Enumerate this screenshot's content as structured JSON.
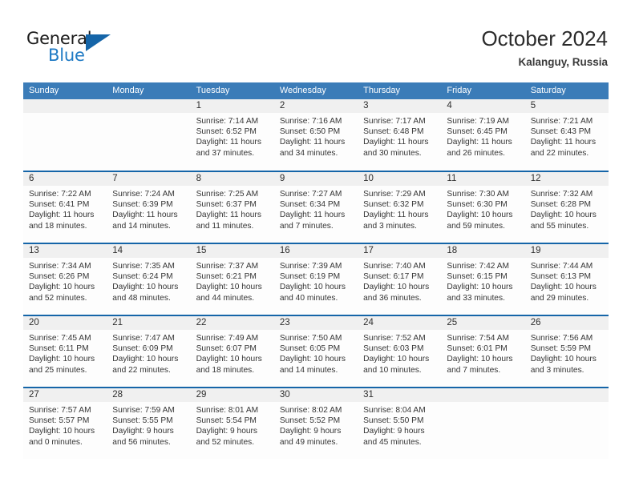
{
  "brand": {
    "name_part1": "General",
    "name_part2": "Blue",
    "accent_color": "#1f7ac4",
    "triangle_color": "#1565a8"
  },
  "header": {
    "title": "October 2024",
    "subtitle": "Kalanguy, Russia"
  },
  "calendar": {
    "header_color": "#3b7cb8",
    "row_rule_color": "#1565a8",
    "day_band_color": "#f0f0f0",
    "weekdays": [
      "Sunday",
      "Monday",
      "Tuesday",
      "Wednesday",
      "Thursday",
      "Friday",
      "Saturday"
    ],
    "weeks": [
      [
        {
          "day": "",
          "info": ""
        },
        {
          "day": "",
          "info": ""
        },
        {
          "day": "1",
          "info": "Sunrise: 7:14 AM\nSunset: 6:52 PM\nDaylight: 11 hours and 37 minutes."
        },
        {
          "day": "2",
          "info": "Sunrise: 7:16 AM\nSunset: 6:50 PM\nDaylight: 11 hours and 34 minutes."
        },
        {
          "day": "3",
          "info": "Sunrise: 7:17 AM\nSunset: 6:48 PM\nDaylight: 11 hours and 30 minutes."
        },
        {
          "day": "4",
          "info": "Sunrise: 7:19 AM\nSunset: 6:45 PM\nDaylight: 11 hours and 26 minutes."
        },
        {
          "day": "5",
          "info": "Sunrise: 7:21 AM\nSunset: 6:43 PM\nDaylight: 11 hours and 22 minutes."
        }
      ],
      [
        {
          "day": "6",
          "info": "Sunrise: 7:22 AM\nSunset: 6:41 PM\nDaylight: 11 hours and 18 minutes."
        },
        {
          "day": "7",
          "info": "Sunrise: 7:24 AM\nSunset: 6:39 PM\nDaylight: 11 hours and 14 minutes."
        },
        {
          "day": "8",
          "info": "Sunrise: 7:25 AM\nSunset: 6:37 PM\nDaylight: 11 hours and 11 minutes."
        },
        {
          "day": "9",
          "info": "Sunrise: 7:27 AM\nSunset: 6:34 PM\nDaylight: 11 hours and 7 minutes."
        },
        {
          "day": "10",
          "info": "Sunrise: 7:29 AM\nSunset: 6:32 PM\nDaylight: 11 hours and 3 minutes."
        },
        {
          "day": "11",
          "info": "Sunrise: 7:30 AM\nSunset: 6:30 PM\nDaylight: 10 hours and 59 minutes."
        },
        {
          "day": "12",
          "info": "Sunrise: 7:32 AM\nSunset: 6:28 PM\nDaylight: 10 hours and 55 minutes."
        }
      ],
      [
        {
          "day": "13",
          "info": "Sunrise: 7:34 AM\nSunset: 6:26 PM\nDaylight: 10 hours and 52 minutes."
        },
        {
          "day": "14",
          "info": "Sunrise: 7:35 AM\nSunset: 6:24 PM\nDaylight: 10 hours and 48 minutes."
        },
        {
          "day": "15",
          "info": "Sunrise: 7:37 AM\nSunset: 6:21 PM\nDaylight: 10 hours and 44 minutes."
        },
        {
          "day": "16",
          "info": "Sunrise: 7:39 AM\nSunset: 6:19 PM\nDaylight: 10 hours and 40 minutes."
        },
        {
          "day": "17",
          "info": "Sunrise: 7:40 AM\nSunset: 6:17 PM\nDaylight: 10 hours and 36 minutes."
        },
        {
          "day": "18",
          "info": "Sunrise: 7:42 AM\nSunset: 6:15 PM\nDaylight: 10 hours and 33 minutes."
        },
        {
          "day": "19",
          "info": "Sunrise: 7:44 AM\nSunset: 6:13 PM\nDaylight: 10 hours and 29 minutes."
        }
      ],
      [
        {
          "day": "20",
          "info": "Sunrise: 7:45 AM\nSunset: 6:11 PM\nDaylight: 10 hours and 25 minutes."
        },
        {
          "day": "21",
          "info": "Sunrise: 7:47 AM\nSunset: 6:09 PM\nDaylight: 10 hours and 22 minutes."
        },
        {
          "day": "22",
          "info": "Sunrise: 7:49 AM\nSunset: 6:07 PM\nDaylight: 10 hours and 18 minutes."
        },
        {
          "day": "23",
          "info": "Sunrise: 7:50 AM\nSunset: 6:05 PM\nDaylight: 10 hours and 14 minutes."
        },
        {
          "day": "24",
          "info": "Sunrise: 7:52 AM\nSunset: 6:03 PM\nDaylight: 10 hours and 10 minutes."
        },
        {
          "day": "25",
          "info": "Sunrise: 7:54 AM\nSunset: 6:01 PM\nDaylight: 10 hours and 7 minutes."
        },
        {
          "day": "26",
          "info": "Sunrise: 7:56 AM\nSunset: 5:59 PM\nDaylight: 10 hours and 3 minutes."
        }
      ],
      [
        {
          "day": "27",
          "info": "Sunrise: 7:57 AM\nSunset: 5:57 PM\nDaylight: 10 hours and 0 minutes."
        },
        {
          "day": "28",
          "info": "Sunrise: 7:59 AM\nSunset: 5:55 PM\nDaylight: 9 hours and 56 minutes."
        },
        {
          "day": "29",
          "info": "Sunrise: 8:01 AM\nSunset: 5:54 PM\nDaylight: 9 hours and 52 minutes."
        },
        {
          "day": "30",
          "info": "Sunrise: 8:02 AM\nSunset: 5:52 PM\nDaylight: 9 hours and 49 minutes."
        },
        {
          "day": "31",
          "info": "Sunrise: 8:04 AM\nSunset: 5:50 PM\nDaylight: 9 hours and 45 minutes."
        },
        {
          "day": "",
          "info": ""
        },
        {
          "day": "",
          "info": ""
        }
      ]
    ]
  }
}
